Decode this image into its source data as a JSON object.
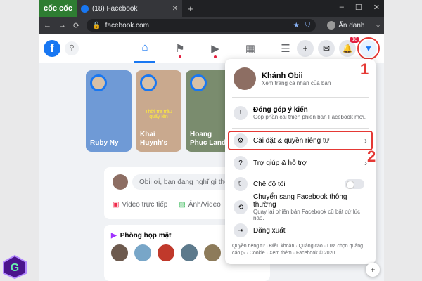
{
  "browser": {
    "brand": "cốc cốc",
    "tab_title": "(18) Facebook",
    "tab_icon": "facebook-icon",
    "url": "facebook.com",
    "profile_label": "Ẩn danh"
  },
  "facebook": {
    "logo": "f",
    "notification_count": "18"
  },
  "stories": [
    {
      "name": "Ruby Ny",
      "bg": "#6f9ad6"
    },
    {
      "name": "Khai Huynh's",
      "caption": "Thời tre trâu quẩy lên",
      "bg": "#c9a98e"
    },
    {
      "name": "Hoang Phuc Land",
      "bg": "#7a8c6e"
    }
  ],
  "composer": {
    "placeholder": "Obii ơi, bạn đang nghĩ gì thế?",
    "live_video": "Video trực tiếp",
    "photo": "Ảnh/Video"
  },
  "room": {
    "title": "Phòng họp mặt"
  },
  "account_menu": {
    "user_name": "Khánh Obii",
    "user_sub": "Xem trang cá nhân của bạn",
    "feedback_title": "Đóng góp ý kiến",
    "feedback_sub": "Góp phần cải thiện phiên bản Facebook mới.",
    "settings": "Cài đặt & quyền riêng tư",
    "help": "Trợ giúp & hỗ trợ",
    "dark_mode": "Chế độ tối",
    "classic_title": "Chuyển sang Facebook thông thường",
    "classic_sub": "Quay lại phiên bản Facebook cũ bất cứ lúc nào.",
    "logout": "Đăng xuất",
    "footer": "Quyền riêng tư · Điều khoản · Quảng cáo · Lựa chọn quảng cáo ▷ · Cookie · Xem thêm · Facebook © 2020"
  },
  "markers": {
    "one": "1",
    "two": "2"
  },
  "colors": {
    "facebook_blue": "#1877f2",
    "highlight_red": "#e53935"
  }
}
